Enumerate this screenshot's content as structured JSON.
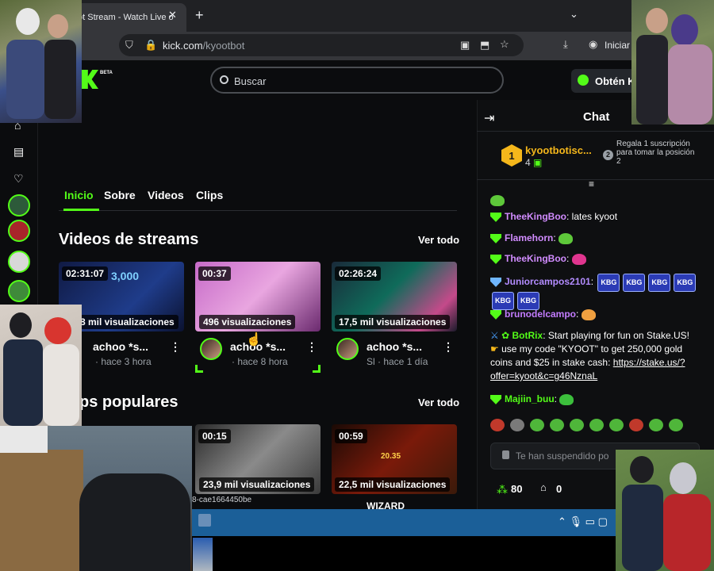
{
  "browser": {
    "tab_title": "ot Stream - Watch Live o",
    "url_host": "kick.com",
    "url_path": "/kyootbot",
    "profile_label": "Iniciar s"
  },
  "header": {
    "logo_badge": "BETA",
    "search_placeholder": "Buscar",
    "get_kick_label": "Obtén K"
  },
  "nav_tabs": [
    "Inicio",
    "Sobre",
    "Videos",
    "Clips"
  ],
  "videos_section": {
    "title": "Videos de streams",
    "see_all": "Ver todo",
    "cards": [
      {
        "duration": "02:31:07",
        "views": "8 mil visualizaciones",
        "overlay_text": "3,000",
        "name": "achoo *s...",
        "meta": "· hace 3 hora"
      },
      {
        "duration": "00:37",
        "views": "496 visualizaciones",
        "name": "achoo *s...",
        "meta": "· hace 8 hora"
      },
      {
        "duration": "02:26:24",
        "views": "17,5 mil visualizaciones",
        "name": "achoo *s...",
        "meta": "Sl · hace 1 día"
      }
    ]
  },
  "clips_section": {
    "title": "ps populares",
    "see_all": "Ver todo",
    "cards": [
      {
        "duration": "00:15",
        "views": "23,9 mil visualizaciones"
      },
      {
        "duration": "00:59",
        "views": "22,5 mil visualizaciones",
        "overlay_text": "20.35",
        "name": "WIZARD"
      }
    ]
  },
  "chat": {
    "title": "Chat",
    "top_gifter": {
      "rank": "1",
      "name": "kyootbotisc...",
      "count": "4"
    },
    "promo": {
      "rank": "2",
      "text": "Regala 1 suscripción para tomar la posición 2"
    },
    "messages": [
      {
        "user": "TheeKingBoo",
        "text": ": lates kyoot",
        "color": "#d18cff"
      },
      {
        "user": "Flamehorn",
        "text": ":",
        "color": "#d18cff"
      },
      {
        "user": "TheeKingBoo",
        "text": ":",
        "color": "#d18cff"
      },
      {
        "user": "Juniorcampos2101",
        "text": ":",
        "color": "#b38cff",
        "emotes": [
          "KBG",
          "KBG",
          "KBG",
          "KBG",
          "KBG",
          "KBG"
        ]
      },
      {
        "user": "brunodelcampo",
        "text": ":",
        "color": "#c37cff"
      },
      {
        "user": "BotRix",
        "text": ": Start playing for fun on Stake.US!",
        "color": "#53fc18"
      },
      {
        "user": "Majiin_buu",
        "text": ":",
        "color": "#53fc18"
      }
    ],
    "botrix_line2": "use my code \"KYOOT\" to get 250,000 gold",
    "botrix_line3": "coins and $25 in stake cash:",
    "botrix_link1": "https://stake.us/?",
    "botrix_link2": "offer=kyoot&c=g46NznaL",
    "input_placeholder": "Te han suspendido po",
    "points": "80",
    "store_count": "0"
  },
  "taskbar": {
    "hash_text": "8-cae1664450be"
  },
  "colors": {
    "accent": "#53fc18",
    "background": "#0b0c0e",
    "gifter_gold": "#f5b71b",
    "taskbar": "#1b5f98"
  }
}
